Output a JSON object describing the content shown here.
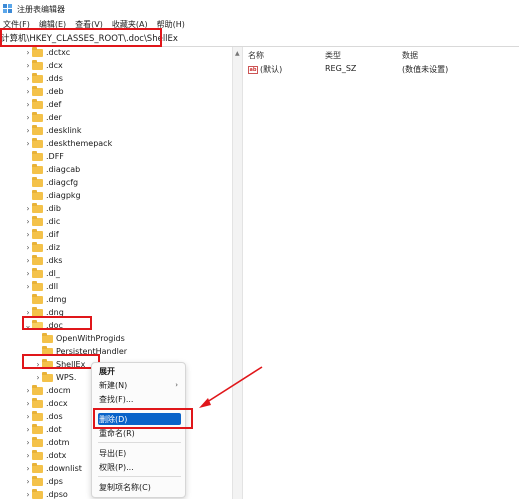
{
  "window": {
    "title": "注册表编辑器",
    "icon": "registry-icon"
  },
  "menubar": [
    "文件(F)",
    "编辑(E)",
    "查看(V)",
    "收藏夹(A)",
    "帮助(H)"
  ],
  "address": "计算机\\HKEY_CLASSES_ROOT\\.doc\\ShellEx",
  "tree": {
    "items": [
      ".dctxc",
      ".dcx",
      ".dds",
      ".deb",
      ".def",
      ".der",
      ".desklink",
      ".deskthemepack",
      ".DFF",
      ".diagcab",
      ".diagcfg",
      ".diagpkg",
      ".dib",
      ".dic",
      ".dif",
      ".diz",
      ".dks",
      ".dl_",
      ".dll",
      ".dmg",
      ".dng",
      ".doc",
      "OpenWithProgids",
      "PersistentHandler",
      "ShellEx",
      "WPS.",
      ".docm",
      ".docx",
      ".dos",
      ".dot",
      ".dotm",
      ".dotx",
      ".downlist",
      ".dps",
      ".dpso"
    ]
  },
  "values": {
    "headers": {
      "name": "名称",
      "type": "类型",
      "data": "数据"
    },
    "rows": [
      {
        "name": "(默认)",
        "type": "REG_SZ",
        "data": "(数值未设置)"
      }
    ]
  },
  "context_menu": {
    "items": [
      {
        "label": "展开",
        "bold": true
      },
      {
        "label": "新建(N)",
        "submenu": true
      },
      {
        "label": "查找(F)..."
      },
      {
        "label": "删除(D)",
        "selected": true
      },
      {
        "label": "重命名(R)"
      },
      {
        "label": "导出(E)"
      },
      {
        "label": "权限(P)..."
      },
      {
        "label": "复制项名称(C)"
      }
    ],
    "submenu_arrow": "›"
  },
  "colors": {
    "highlight_red": "#e0161a",
    "selection_blue": "#0a63c9",
    "folder": "#f4c24a"
  }
}
